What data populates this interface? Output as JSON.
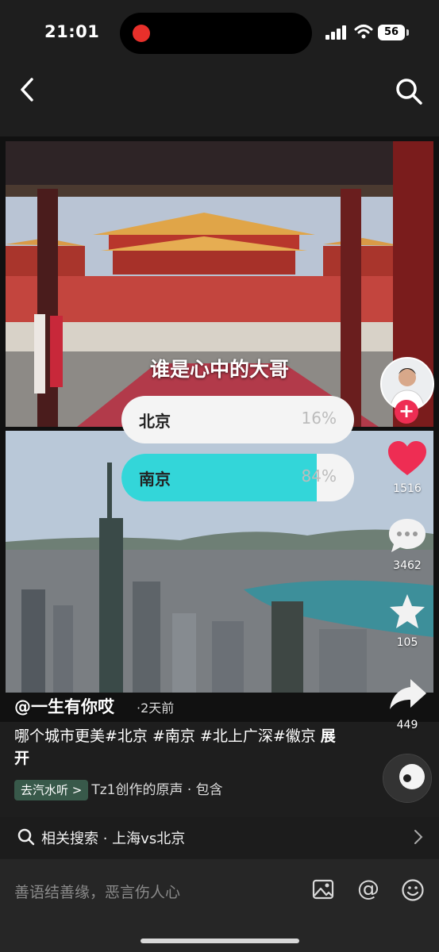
{
  "status_bar": {
    "time": "21:01",
    "battery": "56"
  },
  "video": {
    "question": "谁是心中的大哥",
    "poll": [
      {
        "name": "北京",
        "percent_label": "16%",
        "percent": 16
      },
      {
        "name": "南京",
        "percent_label": "84%",
        "percent": 84
      }
    ],
    "author": "@一生有你哎",
    "post_time": "·2天前"
  },
  "rail": {
    "likes": "1516",
    "comments": "3462",
    "favorites": "105",
    "shares": "449",
    "like_color": "#ee2d53"
  },
  "caption": {
    "text": "哪个城市更美#北京 #南京  #北上广深#徽京",
    "expand": "展开"
  },
  "music": {
    "tag": "去汽水听 >",
    "text": "Tz1创作的原声 · 包含"
  },
  "related_search": {
    "text": "相关搜索 · 上海vs北京"
  },
  "comment_bar": {
    "placeholder": "善语结善缘，恶言伤人心"
  },
  "icons": [
    "back-icon",
    "search-icon",
    "heart-icon",
    "comment-icon",
    "star-icon",
    "share-icon",
    "image-icon",
    "at-icon",
    "emoji-icon"
  ]
}
